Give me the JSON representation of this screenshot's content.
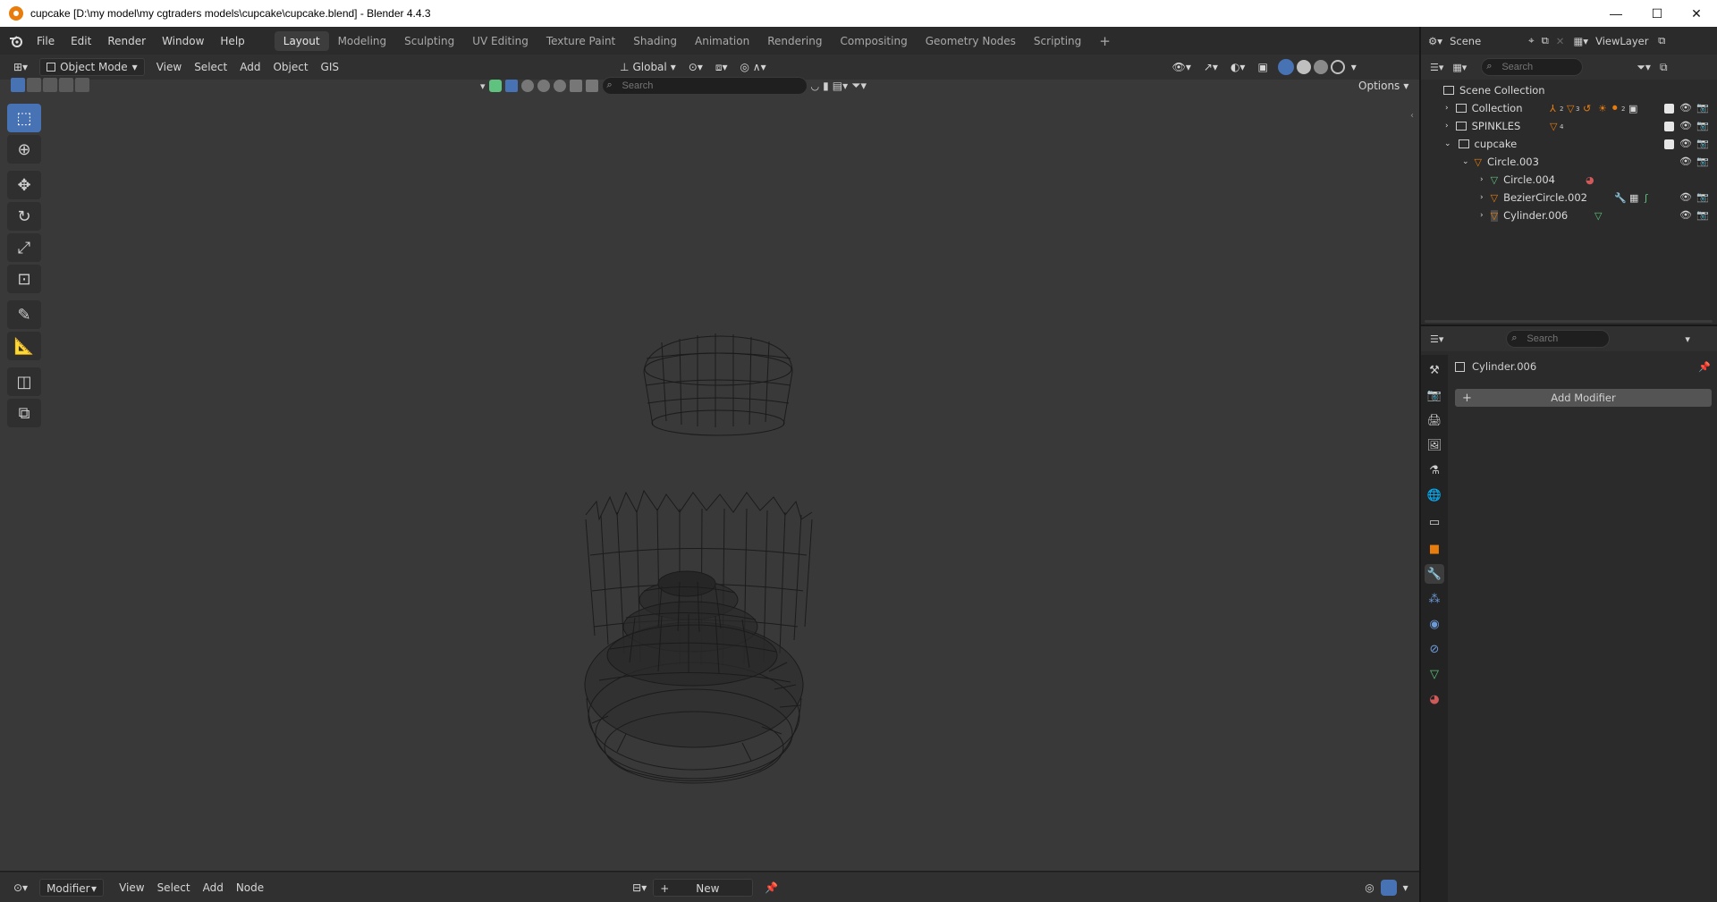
{
  "window": {
    "title": "cupcake [D:\\my model\\my cgtraders models\\cupcake\\cupcake.blend] - Blender 4.4.3",
    "minimize": "—",
    "maximize": "☐",
    "close": "✕"
  },
  "menu": {
    "items": [
      "File",
      "Edit",
      "Render",
      "Window",
      "Help"
    ],
    "workspaces": [
      "Layout",
      "Modeling",
      "Sculpting",
      "UV Editing",
      "Texture Paint",
      "Shading",
      "Animation",
      "Rendering",
      "Compositing",
      "Geometry Nodes",
      "Scripting"
    ],
    "active_workspace": "Layout",
    "add_workspace": "+"
  },
  "scene": {
    "name": "Scene",
    "view_layer": "ViewLayer"
  },
  "viewport_header": {
    "mode": "Object Mode",
    "menus": [
      "View",
      "Select",
      "Add",
      "Object",
      "GIS"
    ],
    "orientation": "Global",
    "search_placeholder": "Search",
    "options": "Options"
  },
  "tools": [
    "select-box-icon",
    "cursor-icon",
    "move-icon",
    "rotate-icon",
    "scale-icon",
    "transform-icon",
    "annotate-icon",
    "measure-icon",
    "add-cube-icon",
    "extrude-icon"
  ],
  "outliner": {
    "search_placeholder": "Search",
    "root": "Scene Collection",
    "rows": [
      {
        "label": "Collection",
        "indent": 0,
        "expanded": false,
        "type": "collection"
      },
      {
        "label": "SPINKLES",
        "indent": 0,
        "expanded": false,
        "type": "collection"
      },
      {
        "label": "cupcake",
        "indent": 0,
        "expanded": true,
        "type": "collection"
      },
      {
        "label": "Circle.003",
        "indent": 1,
        "expanded": true,
        "type": "mesh"
      },
      {
        "label": "Circle.004",
        "indent": 2,
        "expanded": false,
        "type": "mesh"
      },
      {
        "label": "BezierCircle.002",
        "indent": 2,
        "expanded": false,
        "type": "mesh"
      },
      {
        "label": "Cylinder.006",
        "indent": 2,
        "expanded": false,
        "type": "mesh"
      }
    ],
    "badges": {
      "collection_a": "2",
      "collection_b": "3",
      "collection_c": "2",
      "spinkles": "4"
    }
  },
  "properties": {
    "search_placeholder": "Search",
    "object_name": "Cylinder.006",
    "add_modifier": "Add Modifier"
  },
  "bottom_bar": {
    "editor": "Modifier",
    "menus": [
      "View",
      "Select",
      "Add",
      "Node"
    ],
    "new_label": "New"
  },
  "colors": {
    "accent": "#4772b3",
    "viewport_bg": "#393939",
    "panel_bg": "#2b2b2b",
    "orange": "#e87d0d",
    "mesh_green": "#5fc27e"
  }
}
